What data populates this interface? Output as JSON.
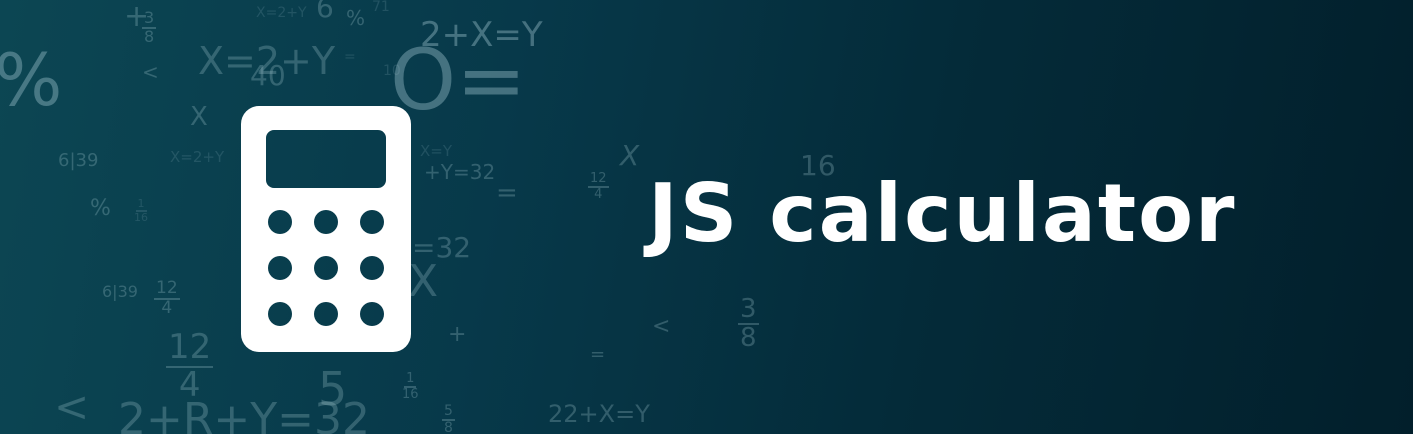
{
  "banner": {
    "title": "JS calculator",
    "icon": "calculator-icon",
    "colors": {
      "background_start": "#0c4653",
      "background_end": "#021f2b",
      "foreground": "#ffffff"
    }
  },
  "background_math": [
    "+",
    "3",
    "8",
    "X=2+Y",
    "6",
    "%",
    "71",
    "%",
    "X=2+Y",
    "40",
    "=",
    "10",
    "X",
    "2+X=Y",
    "O=",
    "<",
    "6|39",
    "X=2+Y",
    "X=Y",
    "+Y=32",
    "X",
    "12",
    "4",
    "16",
    "%",
    "1",
    "16",
    "=",
    "=32",
    "X",
    "6|39",
    "12",
    "4",
    "+",
    "<",
    "3",
    "8",
    "=",
    "12",
    "4",
    "5",
    "<",
    "2+R+Y=32",
    "1",
    "16",
    "5",
    "8",
    "22+X=Y"
  ]
}
